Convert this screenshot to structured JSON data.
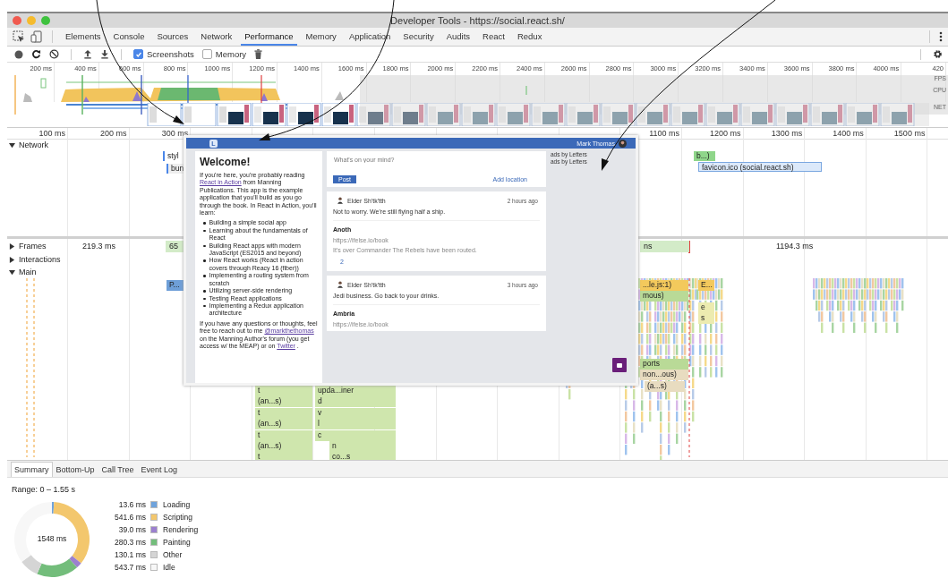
{
  "window": {
    "title": "Developer Tools - https://social.react.sh/"
  },
  "tabs": [
    {
      "label": "Elements",
      "selected": false
    },
    {
      "label": "Console",
      "selected": false
    },
    {
      "label": "Sources",
      "selected": false
    },
    {
      "label": "Network",
      "selected": false
    },
    {
      "label": "Performance",
      "selected": true
    },
    {
      "label": "Memory",
      "selected": false
    },
    {
      "label": "Application",
      "selected": false
    },
    {
      "label": "Security",
      "selected": false
    },
    {
      "label": "Audits",
      "selected": false
    },
    {
      "label": "React",
      "selected": false
    },
    {
      "label": "Redux",
      "selected": false
    }
  ],
  "toolbar": {
    "screenshots": {
      "label": "Screenshots",
      "checked": true
    },
    "memory": {
      "label": "Memory",
      "checked": false
    }
  },
  "overview": {
    "ticks": [
      "200 ms",
      "400 ms",
      "600 ms",
      "800 ms",
      "1000 ms",
      "1200 ms",
      "1400 ms",
      "1600 ms",
      "1800 ms",
      "2000 ms",
      "2200 ms",
      "2400 ms",
      "2600 ms",
      "2800 ms",
      "3000 ms",
      "3200 ms",
      "3400 ms",
      "3600 ms",
      "3800 ms",
      "4000 ms",
      "420"
    ],
    "lanes": [
      "FPS",
      "CPU",
      "NET"
    ]
  },
  "ruler": {
    "ticks": [
      "100 ms",
      "200 ms",
      "300 ms",
      "1100 ms",
      "1200 ms",
      "1300 ms",
      "1400 ms",
      "1500 ms"
    ]
  },
  "tracks": [
    {
      "label": "Network",
      "expanded": true
    },
    {
      "label": "Frames",
      "expanded": false
    },
    {
      "label": "Interactions",
      "expanded": false
    },
    {
      "label": "Main",
      "expanded": true
    }
  ],
  "network_requests": [
    "styl",
    "bun",
    "b...)",
    "favicon.ico (social.react.sh)"
  ],
  "frames": [
    "219.3 ms",
    "65",
    "ns",
    "1194.3 ms"
  ],
  "flame_labels": [
    "P...",
    "...le.js:1)",
    "E...",
    "mous)",
    "e",
    "s",
    "ports",
    "non...ous)",
    "(a...s)",
    "t",
    "upda...iner",
    "(an...s)",
    "d",
    "t",
    "v",
    "(an...s)",
    "l",
    "t",
    "c",
    "(an...s)",
    "n",
    "t",
    "co...s"
  ],
  "screenshot_popup": {
    "header": {
      "logo": "L",
      "user": "Mark Thomas"
    },
    "welcome": {
      "title": "Welcome!",
      "intro": [
        {
          "kind": "text",
          "text": "If you're here, you're probably reading "
        },
        {
          "kind": "link",
          "text": "React in Action"
        },
        {
          "kind": "text",
          "text": " from Manning Publications. This app is the example application that you'll build as you go through the book. In React in Action, you'll learn:"
        }
      ],
      "topics": [
        "Building a simple social app",
        "Learning about the fundamentals of React",
        "Building React apps with modern JavaScript (ES2015 and beyond)",
        "How React works (React in action covers through Reacy 16 (fiber))",
        "Implementing a routing system from scratch",
        "Utilizing server-side rendering",
        "Testing React applications",
        "Implementing a Redux application architecture"
      ],
      "outro": [
        {
          "kind": "text",
          "text": "If you have any questions or thoughts, feel free to reach out to me "
        },
        {
          "kind": "link",
          "text": "@markthethomas"
        },
        {
          "kind": "text",
          "text": " on the Manning Author's forum (you get access w/ the MEAP) or on "
        },
        {
          "kind": "link",
          "text": "Twitter"
        },
        {
          "kind": "text",
          "text": " ."
        }
      ]
    },
    "composer": {
      "placeholder": "What's on your mind?",
      "post_button": "Post",
      "location_link": "Add location"
    },
    "ads": [
      "ads by Letters",
      "ads by Letters"
    ],
    "posts": [
      {
        "author": "Elder Sh'tk'tth",
        "time": "2 hours ago",
        "text": "Not to worry. We're still flying half a ship.",
        "comment": {
          "author": "Anoth",
          "link": "https://ifelse.io/book",
          "text": "It's over Commander The Rebels have been routed."
        },
        "count": "2"
      },
      {
        "author": "Elder Sh'tk'tth",
        "time": "3 hours ago",
        "text": "Jedi business. Go back to your drinks.",
        "comment": {
          "author": "Ambria",
          "link": "https://ifelse.io/book"
        }
      }
    ]
  },
  "bottom_tabs": [
    {
      "label": "Summary",
      "selected": true
    },
    {
      "label": "Bottom-Up",
      "selected": false
    },
    {
      "label": "Call Tree",
      "selected": false
    },
    {
      "label": "Event Log",
      "selected": false
    }
  ],
  "summary": {
    "range": "Range: 0 – 1.55 s",
    "total": "1548 ms",
    "legend": [
      {
        "value": "13.6 ms",
        "color": "#6fa3dc"
      },
      {
        "value": "541.6 ms",
        "color": "#f3c76d"
      },
      {
        "value": "39.0 ms",
        "color": "#9b80cf"
      },
      {
        "value": "280.3 ms",
        "color": "#73bd7b"
      },
      {
        "value": "130.1 ms",
        "color": "#d5d5d5"
      },
      {
        "value": "543.7 ms",
        "color": "#f7f7f7"
      }
    ],
    "chart_data": {
      "type": "donut",
      "categories": [
        "Loading",
        "Scripting",
        "Rendering",
        "Painting",
        "Other",
        "Idle"
      ],
      "series": [
        {
          "values": [
            0.88,
            34.98,
            2.52,
            18.1,
            8.4,
            35.12
          ]
        }
      ]
    }
  }
}
